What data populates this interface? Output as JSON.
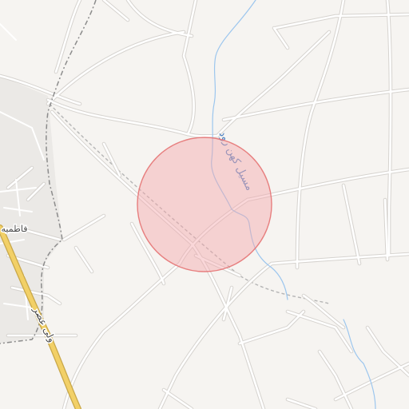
{
  "map": {
    "labels": {
      "stream": "مسیل کهن رود",
      "highway": "ولی عصر",
      "town": "فاطمیه"
    },
    "colors": {
      "background": "#f6f4f1",
      "urban_area": "#ebe9e6",
      "minor_road": "#ffffff",
      "road_casing": "#d6d3cf",
      "highway": "#f2d067",
      "highway_casing": "#c9a84a",
      "waterway": "#9cc6ee",
      "boundary": "#8c8c8c",
      "railway": "#b5b5b5",
      "marker_fill": "#f4a7aa",
      "marker_stroke": "#e57373"
    },
    "marker": {
      "shape": "circle",
      "opacity": 0.45
    }
  }
}
